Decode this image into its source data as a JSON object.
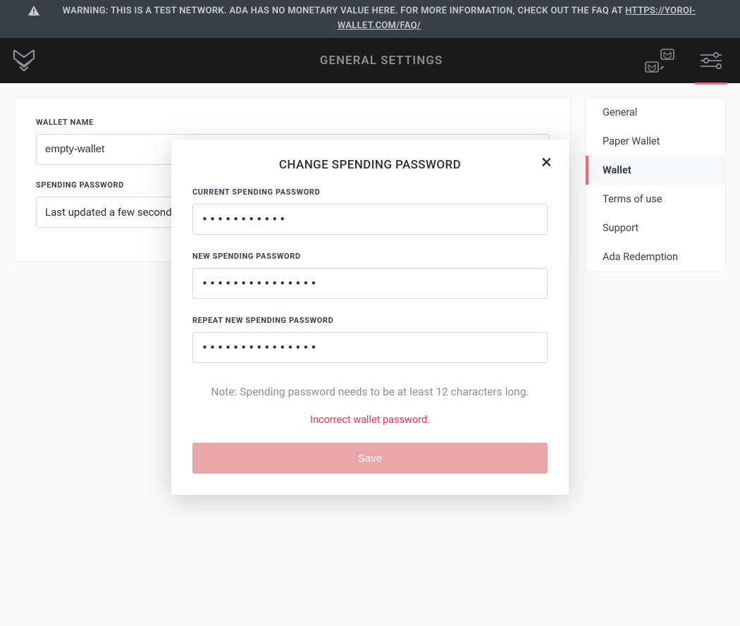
{
  "banner": {
    "text": "WARNING: THIS IS A TEST NETWORK. ADA HAS NO MONETARY VALUE HERE. FOR MORE INFORMATION, CHECK OUT THE FAQ AT ",
    "link": "HTTPS://YOROI-WALLET.COM/FAQ/"
  },
  "header": {
    "title": "GENERAL SETTINGS"
  },
  "wallet_panel": {
    "name_label": "WALLET NAME",
    "name_value": "empty-wallet",
    "password_label": "SPENDING PASSWORD",
    "password_status": "Last updated a few seconds ago"
  },
  "sidebar": {
    "items": [
      {
        "label": "General",
        "active": false
      },
      {
        "label": "Paper Wallet",
        "active": false
      },
      {
        "label": "Wallet",
        "active": true
      },
      {
        "label": "Terms of use",
        "active": false
      },
      {
        "label": "Support",
        "active": false
      },
      {
        "label": "Ada Redemption",
        "active": false
      }
    ]
  },
  "modal": {
    "title": "CHANGE SPENDING PASSWORD",
    "current_label": "CURRENT SPENDING PASSWORD",
    "current_value": "•••••••••••",
    "new_label": "NEW SPENDING PASSWORD",
    "new_value": "•••••••••••••••",
    "repeat_label": "REPEAT NEW SPENDING PASSWORD",
    "repeat_value": "•••••••••••••••",
    "note": "Note: Spending password needs to be at least 12 characters long.",
    "error": "Incorrect wallet password.",
    "save_label": "Save"
  },
  "colors": {
    "accent": "#eb6d7a",
    "error": "#e6394a"
  }
}
